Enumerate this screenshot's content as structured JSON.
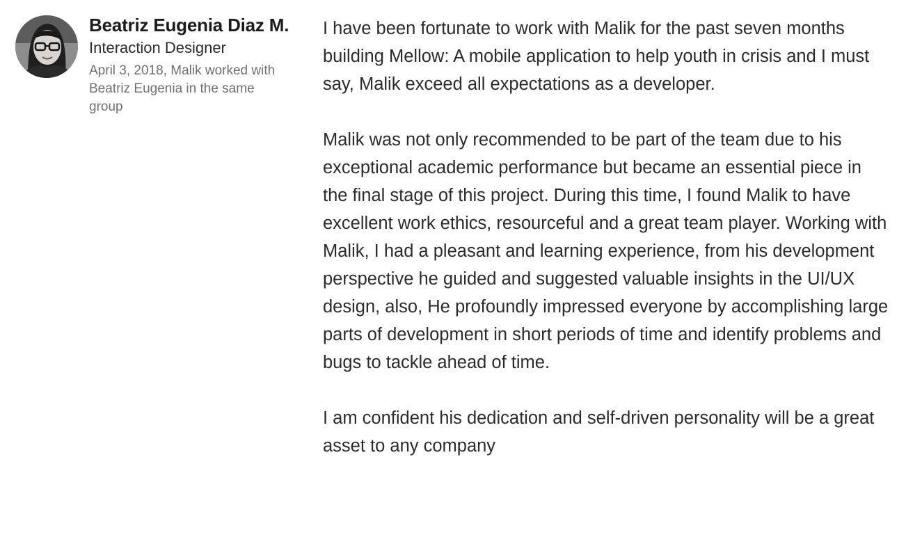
{
  "recommendation": {
    "avatar_icon": "profile-photo-avatar",
    "author": {
      "name": "Beatriz Eugenia Diaz M.",
      "title": "Interaction Designer",
      "meta": "April 3, 2018, Malik worked with Beatriz Eugenia in the same group"
    },
    "paragraphs": [
      "I have been fortunate to work with Malik for the past seven months building Mellow: A mobile application to help youth in crisis and I must say, Malik exceed all expectations as a developer.",
      "Malik was not only recommended to be part of the team due to his exceptional academic performance but became an essential piece in the final stage of this project. During this time, I found Malik to have excellent work ethics, resourceful and a great team player. Working with Malik, I had a pleasant and learning experience, from his development perspective he guided and suggested valuable insights in the UI/UX design, also, He profoundly impressed everyone by accomplishing large parts of development in short periods of time and identify problems and bugs to tackle ahead of time.",
      "I am confident his dedication and self-driven personality will be a great asset to any company"
    ]
  }
}
